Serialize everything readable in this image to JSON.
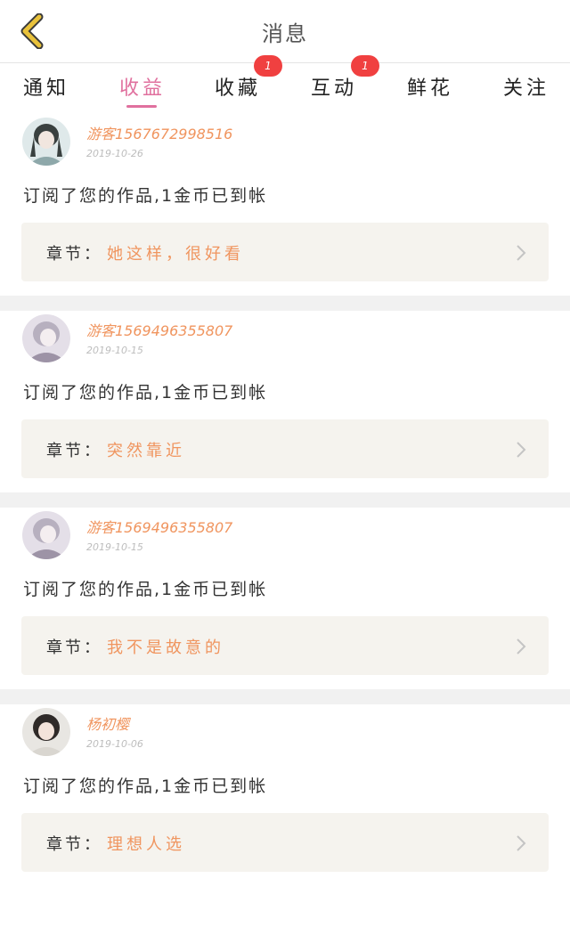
{
  "header": {
    "title": "消息",
    "back_icon": "chevron-left-icon",
    "back_color": "#e9c23b"
  },
  "tabs": [
    {
      "label": "通知",
      "active": false
    },
    {
      "label": "收益",
      "active": true
    },
    {
      "label": "收藏",
      "active": false,
      "badge": "1"
    },
    {
      "label": "互动",
      "active": false,
      "badge": "1"
    },
    {
      "label": "鲜花",
      "active": false
    },
    {
      "label": "关注",
      "active": false
    }
  ],
  "colors": {
    "accent": "#e0709e",
    "name": "#f0955f",
    "badge": "#f04040"
  },
  "items": [
    {
      "user": "游客1567672998516",
      "date": "2019-10-26",
      "message": "订阅了您的作品,1金币已到帐",
      "chapter_label": "章节：",
      "chapter_title": "她这样，很好看"
    },
    {
      "user": "游客1569496355807",
      "date": "2019-10-15",
      "message": "订阅了您的作品,1金币已到帐",
      "chapter_label": "章节：",
      "chapter_title": "突然靠近"
    },
    {
      "user": "游客1569496355807",
      "date": "2019-10-15",
      "message": "订阅了您的作品,1金币已到帐",
      "chapter_label": "章节：",
      "chapter_title": "我不是故意的"
    },
    {
      "user": "杨初樱",
      "date": "2019-10-06",
      "message": "订阅了您的作品,1金币已到帐",
      "chapter_label": "章节：",
      "chapter_title": "理想人选"
    }
  ]
}
